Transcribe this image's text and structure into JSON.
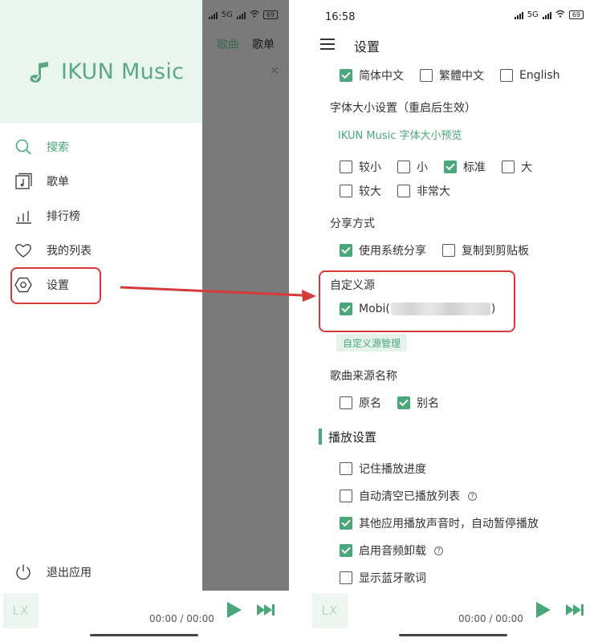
{
  "status": {
    "time": "16:58",
    "network_label": "5G",
    "battery": "69"
  },
  "left": {
    "behind_tabs": [
      "歌曲",
      "歌单"
    ],
    "behind_close": "×",
    "app_name": "IKUN Music",
    "menu": [
      {
        "label": "搜索",
        "icon": "search-icon",
        "active": true
      },
      {
        "label": "歌单",
        "icon": "playlist-icon"
      },
      {
        "label": "排行榜",
        "icon": "chart-icon"
      },
      {
        "label": "我的列表",
        "icon": "heart-icon"
      },
      {
        "label": "设置",
        "icon": "settings-icon"
      }
    ],
    "exit_label": "退出应用"
  },
  "player": {
    "logo_text": "LX",
    "time": "00:00 / 00:00"
  },
  "settings": {
    "title": "设置",
    "language": {
      "options": [
        "简体中文",
        "繁體中文",
        "English"
      ],
      "checked": [
        true,
        false,
        false
      ]
    },
    "font_size": {
      "label": "字体大小设置（重启后生效）",
      "preview": "IKUN Music 字体大小预览",
      "options": [
        "较小",
        "小",
        "标准",
        "大",
        "较大",
        "非常大"
      ],
      "checked": [
        false,
        false,
        true,
        false,
        false,
        false
      ]
    },
    "share": {
      "label": "分享方式",
      "options": [
        "使用系统分享",
        "复制到剪贴板"
      ],
      "checked": [
        true,
        false
      ]
    },
    "custom_source": {
      "label": "自定义源",
      "source_prefix": "Mobi(",
      "source_suffix": ")",
      "checked": true,
      "manage_button": "自定义源管理"
    },
    "song_source_name": {
      "label": "歌曲来源名称",
      "options": [
        "原名",
        "别名"
      ],
      "checked": [
        false,
        true
      ]
    },
    "playback": {
      "heading": "播放设置",
      "options": [
        "记住播放进度",
        "自动清空已播放列表",
        "其他应用播放声音时，自动暂停播放",
        "启用音频卸载",
        "显示蓝牙歌词"
      ],
      "checked": [
        false,
        false,
        true,
        true,
        false
      ],
      "help": [
        false,
        true,
        false,
        true,
        false
      ],
      "help_glyph": "?"
    }
  },
  "colors": {
    "accent": "#4aa77a",
    "highlight": "#d63a3a",
    "drawer_header": "#e9f6ef",
    "overlay": "#7a7a7a"
  }
}
